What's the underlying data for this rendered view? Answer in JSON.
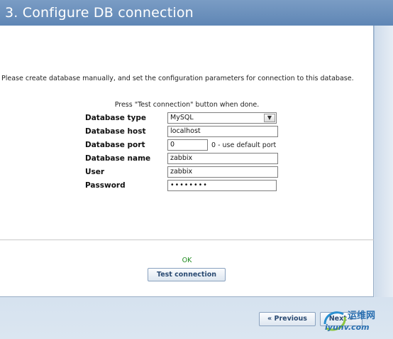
{
  "title": "3. Configure DB connection",
  "intro_text": "Please create database manually, and set the configuration parameters for connection to this database.",
  "hint_text": "Press \"Test connection\" button when done.",
  "form": {
    "db_type": {
      "label": "Database type",
      "value": "MySQL"
    },
    "db_host": {
      "label": "Database host",
      "value": "localhost"
    },
    "db_port": {
      "label": "Database port",
      "value": "0",
      "note": "0 - use default port"
    },
    "db_name": {
      "label": "Database name",
      "value": "zabbix"
    },
    "user": {
      "label": "User",
      "value": "zabbix"
    },
    "password": {
      "label": "Password",
      "value": "••••••••"
    }
  },
  "status": "OK",
  "buttons": {
    "test": "Test connection",
    "previous": "« Previous",
    "next": "Next »"
  },
  "watermark": {
    "logo_text": "运维网",
    "url": "iyunv.com"
  },
  "colors": {
    "title_bar": "#6a8fbb",
    "status_ok": "#1e8a1e",
    "button_text": "#2a4a72"
  }
}
